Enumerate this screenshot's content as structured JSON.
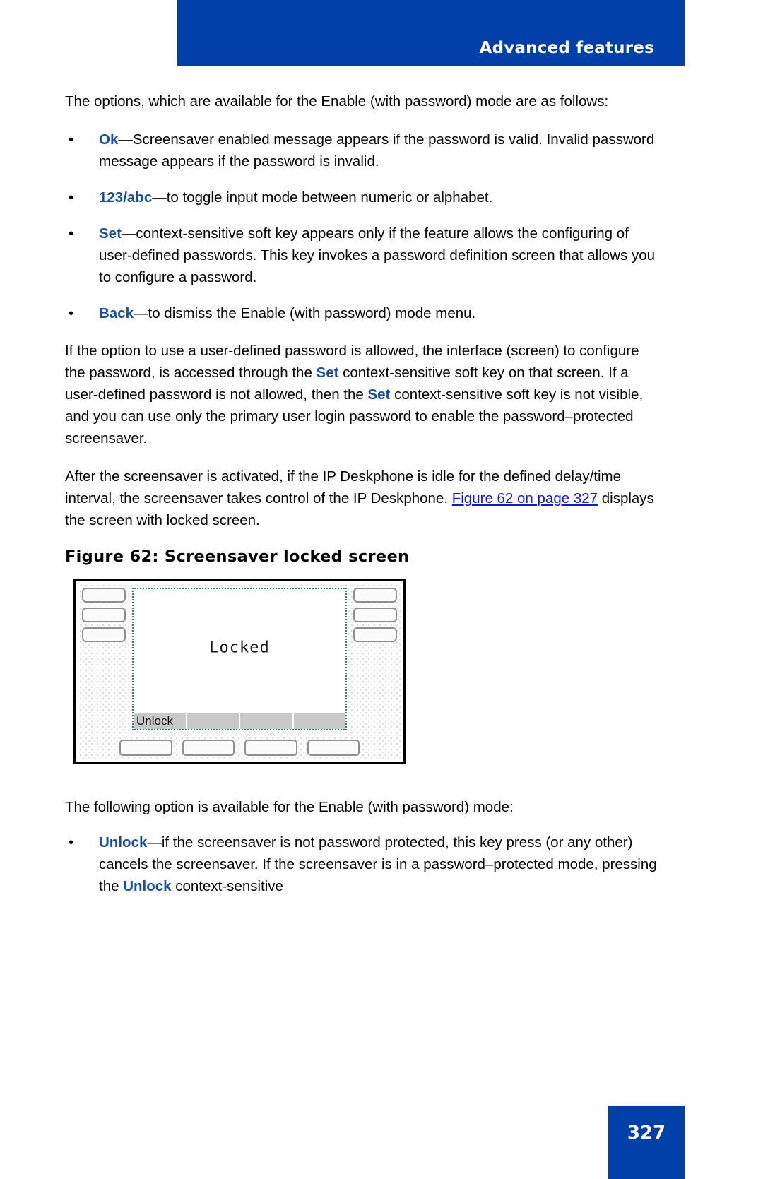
{
  "header": {
    "title": "Advanced features",
    "banner_color": "#0040a8"
  },
  "colors": {
    "banner": "#0040a8",
    "keyword": "#1a4fa0",
    "hyperlink": "#0f15e8",
    "body_text": "#010101"
  },
  "intro_paragraph": "The options, which are available for the Enable (with password) mode are as follows:",
  "options_list": [
    {
      "bullet": "•",
      "keyword": "Ok",
      "dash": "—",
      "text": "Screensaver enabled message appears if the password is valid. Invalid password message appears if the password is invalid."
    },
    {
      "bullet": "•",
      "keyword": "123/abc",
      "dash": "—",
      "text": "to toggle input mode between numeric or alphabet."
    },
    {
      "bullet": "•",
      "keyword": "Set",
      "dash": "—",
      "text": "context-sensitive soft key appears only if the feature allows the configuring of user-defined passwords. This key invokes a password definition screen that allows you to configure a password."
    },
    {
      "bullet": "•",
      "keyword": "Back",
      "dash": "—",
      "text": "to dismiss the Enable (with password) mode menu."
    }
  ],
  "paragraph_userdefined": {
    "part1": "If the option to use a user-defined password is allowed, the interface (screen) to configure the password, is accessed through the ",
    "kw1": "Set",
    "part2": " context-sensitive soft key on that screen. If a user-defined password is not allowed, then the ",
    "kw2": "Set",
    "part3": " context-sensitive soft key is not visible, and you can use only the primary user login password to enable the password–protected screensaver."
  },
  "paragraph_activated": {
    "part1": "After the screensaver is activated, if the IP Deskphone is idle for the defined delay/time interval, the screensaver takes control of the IP Deskphone. ",
    "xref": "Figure 62 on page 327",
    "part2": " displays the screen with locked screen."
  },
  "figure": {
    "caption": "Figure 62: Screensaver locked screen",
    "lcd_text": "Locked",
    "soft_labels": [
      "Unlock",
      "",
      "",
      ""
    ],
    "feature_keys_left": [
      "",
      "",
      ""
    ],
    "feature_keys_right": [
      "",
      "",
      ""
    ],
    "soft_keys": [
      "",
      "",
      "",
      ""
    ]
  },
  "following_option_paragraph": "The following option is available for the Enable (with password) mode:",
  "unlock_list": [
    {
      "bullet": "•",
      "keyword": "Unlock",
      "dash": "—",
      "text_before": "if the screensaver is not password protected, this key press (or any other) cancels the screensaver. If the screensaver is in a password–protected mode, pressing the ",
      "keyword2": "Unlock",
      "text_after": " context-sensitive"
    }
  ],
  "footer": {
    "page_number": "327"
  }
}
